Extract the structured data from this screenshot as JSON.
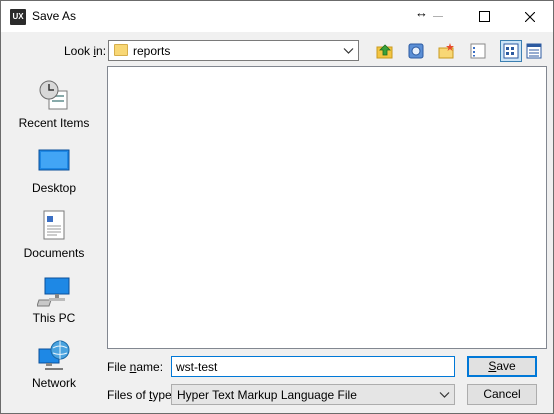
{
  "window": {
    "title": "Save As",
    "app_icon_text": "UX",
    "resize_glyph": "↔"
  },
  "look_in": {
    "label_prefix": "Look ",
    "label_accel": "i",
    "label_suffix": "n:",
    "value": "reports"
  },
  "toolbar": {
    "icons": [
      "up-folder-icon",
      "desktop-shortcut-icon",
      "new-folder-icon",
      "list-view-icon",
      "details-view-icon",
      "thumbnails-view-icon"
    ]
  },
  "places": [
    {
      "label": "Recent Items",
      "icon": "recent-items-icon"
    },
    {
      "label": "Desktop",
      "icon": "desktop-icon"
    },
    {
      "label": "Documents",
      "icon": "documents-icon"
    },
    {
      "label": "This PC",
      "icon": "this-pc-icon"
    },
    {
      "label": "Network",
      "icon": "network-icon"
    }
  ],
  "file_name": {
    "label_prefix": "File ",
    "label_accel": "n",
    "label_suffix": "ame:",
    "value": "wst-test"
  },
  "file_type": {
    "label_prefix": "Files of ",
    "label_accel": "t",
    "label_suffix": "ype:",
    "value": "Hyper Text Markup Language File"
  },
  "buttons": {
    "save_accel": "S",
    "save_rest": "ave",
    "cancel": "Cancel"
  },
  "colors": {
    "accent": "#0078d7",
    "folder": "#f8d775"
  }
}
